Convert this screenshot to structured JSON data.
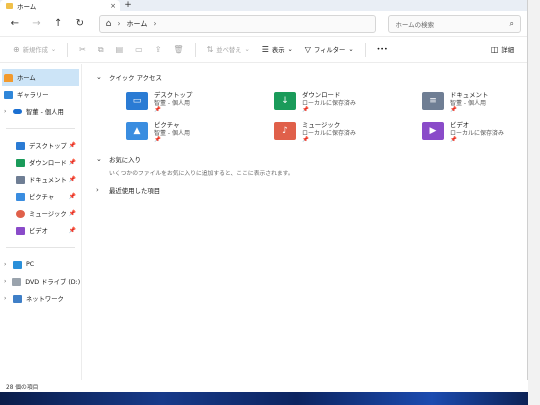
{
  "tab": {
    "title": "ホーム",
    "close": "×",
    "add": "+"
  },
  "nav": {
    "back": "←",
    "forward": "→",
    "up": "↑",
    "refresh": "↻"
  },
  "address": {
    "home_icon": "⌂",
    "chevron": "›",
    "crumb": "ホーム"
  },
  "search": {
    "placeholder": "ホームの検索",
    "icon": "⌕"
  },
  "commands": {
    "new": "新規作成",
    "sort": "並べ替え",
    "view": "表示",
    "filter": "フィルター",
    "more": "•••",
    "details": "詳細"
  },
  "sidebar": {
    "home": "ホーム",
    "gallery": "ギャラリー",
    "onedrive": "智董 - 個人用",
    "pinned": [
      {
        "label": "デスクトップ",
        "color": "#2a7bd4"
      },
      {
        "label": "ダウンロード",
        "color": "#1a9b5a"
      },
      {
        "label": "ドキュメント",
        "color": "#6f7e94"
      },
      {
        "label": "ピクチャ",
        "color": "#3a8de0"
      },
      {
        "label": "ミュージック",
        "color": "#e0604a"
      },
      {
        "label": "ビデオ",
        "color": "#8a4bc9"
      }
    ],
    "pc": "PC",
    "dvd": "DVD ドライブ (D:) CC",
    "network": "ネットワーク"
  },
  "quick_access": {
    "title": "クイック アクセス",
    "items": [
      {
        "name": "デスクトップ",
        "sub": "智董 - 個人用",
        "color": "#2a7bd4",
        "glyph": "▭"
      },
      {
        "name": "ダウンロード",
        "sub": "ローカルに保存済み",
        "color": "#1a9b5a",
        "glyph": "↓"
      },
      {
        "name": "ドキュメント",
        "sub": "智董 - 個人用",
        "color": "#6f7e94",
        "glyph": "≡"
      },
      {
        "name": "ピクチャ",
        "sub": "智董 - 個人用",
        "color": "#3a8de0",
        "glyph": "▲"
      },
      {
        "name": "ミュージック",
        "sub": "ローカルに保存済み",
        "color": "#e0604a",
        "glyph": "♪"
      },
      {
        "name": "ビデオ",
        "sub": "ローカルに保存済み",
        "color": "#8a4bc9",
        "glyph": "▶"
      }
    ]
  },
  "favorites": {
    "title": "お気に入り",
    "hint": "いくつかのファイルをお気に入りに追加すると、ここに表示されます。"
  },
  "recent": {
    "title": "最近使用した項目"
  },
  "status": {
    "count": "28 個の項目"
  }
}
